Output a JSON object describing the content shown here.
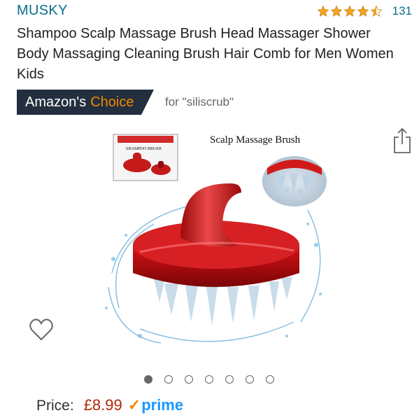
{
  "brand": "MUSKY",
  "rating": {
    "value": 4.5,
    "count": "131"
  },
  "title": "Shampoo Scalp Massage Brush Head Massager Shower Body Massaging Cleaning Brush Hair Comb for Men Women Kids",
  "choice": {
    "badge_prefix": "Amazon's",
    "badge_word": "Choice",
    "for_text": "for \"siliscrub\""
  },
  "image": {
    "caption": "Scalp Massage Brush",
    "box_label": "SHAMPOO BRUSH"
  },
  "carousel": {
    "count": 7,
    "active": 0
  },
  "price": {
    "label": "Price:",
    "value": "£8.99",
    "prime_label": "prime"
  },
  "icons": {
    "share": "share-icon",
    "wishlist": "heart-icon",
    "star": "star-icon"
  },
  "colors": {
    "link": "#0a6e8c",
    "badge_bg": "#232f3e",
    "choice_orange": "#f08804",
    "price_red": "#b12704",
    "prime_blue": "#1a98ff",
    "star": "#f4a41c"
  }
}
